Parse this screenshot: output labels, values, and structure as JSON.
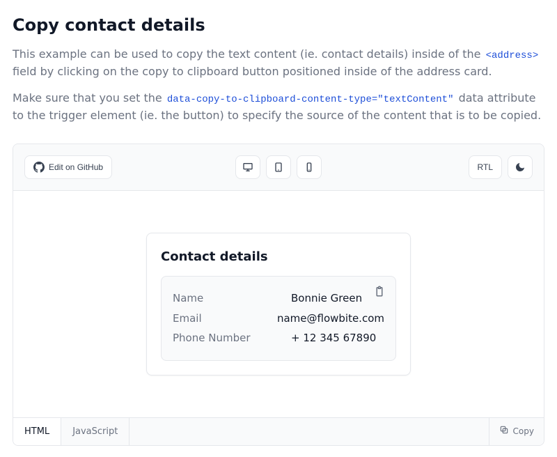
{
  "heading": "Copy contact details",
  "para1": {
    "before": "This example can be used to copy the text content (ie. contact details) inside of the ",
    "code": "<address>",
    "after": " field by clicking on the copy to clipboard button positioned inside of the address card."
  },
  "para2": {
    "before": "Make sure that you set the ",
    "code": "data-copy-to-clipboard-content-type=\"textContent\"",
    "after": " data attribute to the trigger element (ie. the button) to specify the source of the content that is to be copied."
  },
  "toolbar": {
    "edit_label": "Edit on GitHub",
    "rtl_label": "RTL"
  },
  "card": {
    "title": "Contact details",
    "labels": {
      "name": "Name",
      "email": "Email",
      "phone": "Phone Number"
    },
    "values": {
      "name": "Bonnie Green",
      "email": "name@flowbite.com",
      "phone": "+ 12 345 67890"
    }
  },
  "tabs": {
    "html": "HTML",
    "js": "JavaScript",
    "copy": "Copy"
  }
}
